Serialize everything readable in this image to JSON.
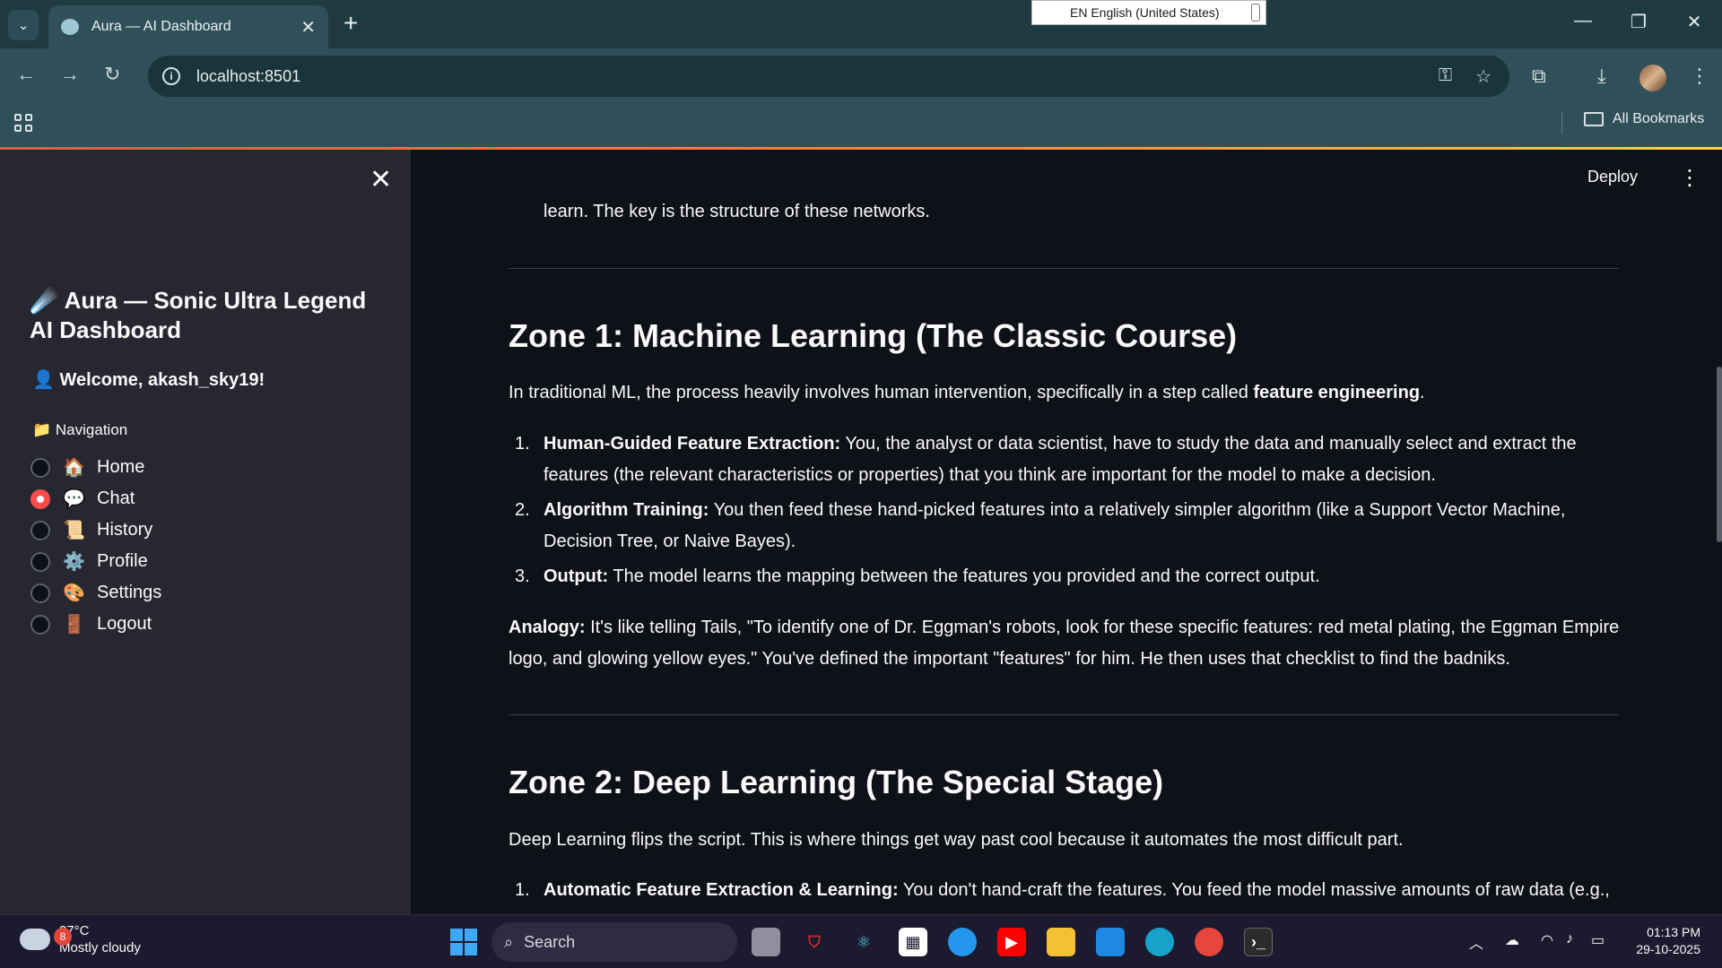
{
  "browser": {
    "tab_title": "Aura — AI Dashboard",
    "url": "localhost:8501",
    "language_indicator": "EN English (United States)",
    "all_bookmarks": "All Bookmarks"
  },
  "app": {
    "deploy_label": "Deploy",
    "sidebar": {
      "title_emoji": "☄️",
      "title": "Aura — Sonic Ultra Legend AI Dashboard",
      "welcome_emoji": "👤",
      "welcome": "Welcome, akash_sky19!",
      "nav_emoji": "📁",
      "nav_label": "Navigation",
      "items": [
        {
          "emoji": "🏠",
          "label": "Home",
          "selected": false
        },
        {
          "emoji": "💬",
          "label": "Chat",
          "selected": true
        },
        {
          "emoji": "📜",
          "label": "History",
          "selected": false
        },
        {
          "emoji": "⚙️",
          "label": "Profile",
          "selected": false
        },
        {
          "emoji": "🎨",
          "label": "Settings",
          "selected": false
        },
        {
          "emoji": "🚪",
          "label": "Logout",
          "selected": false
        }
      ]
    },
    "content": {
      "intro_tail": "learn. The key is the structure of these networks.",
      "zone1": {
        "heading": "Zone 1: Machine Learning (The Classic Course)",
        "intro_pre": "In traditional ML, the process heavily involves human intervention, specifically in a step called ",
        "intro_bold": "feature engineering",
        "intro_post": ".",
        "items": [
          {
            "num": "1.",
            "bold": "Human-Guided Feature Extraction:",
            "text": " You, the analyst or data scientist, have to study the data and manually select and extract the features (the relevant characteristics or properties) that you think are important for the model to make a decision."
          },
          {
            "num": "2.",
            "bold": "Algorithm Training:",
            "text": " You then feed these hand-picked features into a relatively simpler algorithm (like a Support Vector Machine, Decision Tree, or Naive Bayes)."
          },
          {
            "num": "3.",
            "bold": "Output:",
            "text": " The model learns the mapping between the features you provided and the correct output."
          }
        ],
        "analogy_bold": "Analogy:",
        "analogy_text": " It's like telling Tails, \"To identify one of Dr. Eggman's robots, look for these specific features: red metal plating, the Eggman Empire logo, and glowing yellow eyes.\" You've defined the important \"features\" for him. He then uses that checklist to find the badniks."
      },
      "zone2": {
        "heading": "Zone 2: Deep Learning (The Special Stage)",
        "intro": "Deep Learning flips the script. This is where things get way past cool because it automates the most difficult part.",
        "items": [
          {
            "num": "1.",
            "bold": "Automatic Feature Extraction & Learning:",
            "text": " You don't hand-craft the features. You feed the model massive amounts of raw data (e.g.,"
          }
        ]
      }
    }
  },
  "taskbar": {
    "weather_badge": "8",
    "temperature": "27°C",
    "condition": "Mostly cloudy",
    "search_label": "Search",
    "time": "01:13 PM",
    "date": "29-10-2025"
  }
}
